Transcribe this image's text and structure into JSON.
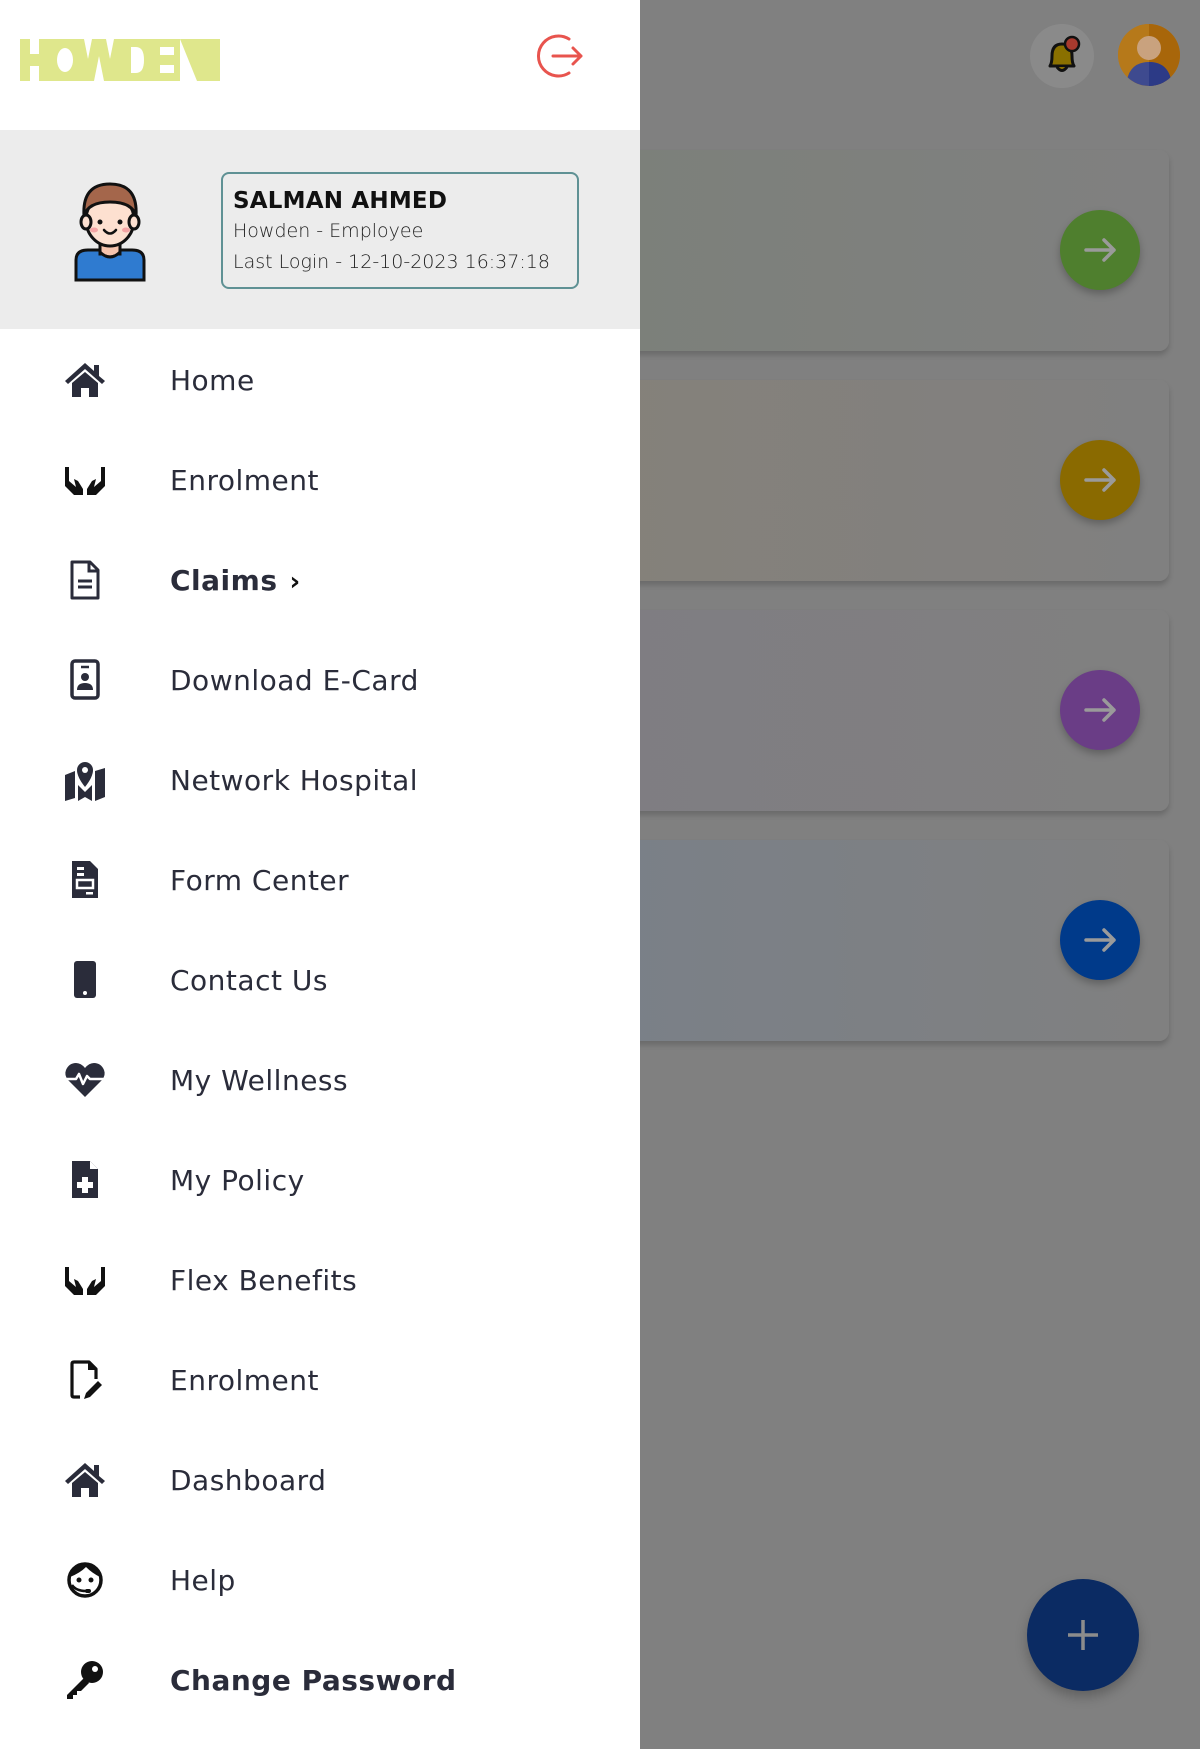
{
  "app": {
    "brand": "HOWDEN",
    "colors": {
      "brand_logo": "#dfe78c",
      "logout": "#e8544e",
      "scrim": "#808080",
      "profile_bg": "#ececec",
      "profile_border": "#5f9194",
      "menu_text": "#2a2c3a",
      "fab": "#0b2b63"
    }
  },
  "drawer": {
    "logout_icon": "logout-icon",
    "profile": {
      "name": "SALMAN AHMED",
      "role": "Howden - Employee",
      "last_login": "Last Login - 12-10-2023 16:37:18"
    },
    "menu": [
      {
        "label": "Home",
        "icon": "home-icon",
        "bold": false
      },
      {
        "label": "Enrolment",
        "icon": "hands-icon",
        "bold": false
      },
      {
        "label": "Claims",
        "icon": "document-icon",
        "bold": true,
        "chevron": "›"
      },
      {
        "label": "Download E-Card",
        "icon": "id-card-icon",
        "bold": false
      },
      {
        "label": "Network Hospital",
        "icon": "map-pin-icon",
        "bold": false
      },
      {
        "label": "Form Center",
        "icon": "form-icon",
        "bold": false
      },
      {
        "label": "Contact Us",
        "icon": "mobile-phone-icon",
        "bold": false
      },
      {
        "label": "My Wellness",
        "icon": "heart-pulse-icon",
        "bold": false
      },
      {
        "label": "My Policy",
        "icon": "file-medical-icon",
        "bold": false
      },
      {
        "label": "Flex Benefits",
        "icon": "hands-icon",
        "bold": false
      },
      {
        "label": "Enrolment",
        "icon": "file-edit-icon",
        "bold": false
      },
      {
        "label": "Dashboard",
        "icon": "home-icon",
        "bold": false
      },
      {
        "label": "Help",
        "icon": "support-agent-icon",
        "bold": false
      },
      {
        "label": "Change Password",
        "icon": "key-icon",
        "bold": true
      }
    ]
  },
  "background": {
    "header": {
      "notification_icon": "bell-icon",
      "avatar_icon": "user-avatar-icon"
    },
    "cards": [
      {
        "arrow_color": "#4f7f2e"
      },
      {
        "arrow_color": "#8a6a00"
      },
      {
        "arrow_color": "#6a3d86"
      },
      {
        "arrow_color": "#003a8a"
      }
    ],
    "fab_icon": "plus-icon"
  }
}
